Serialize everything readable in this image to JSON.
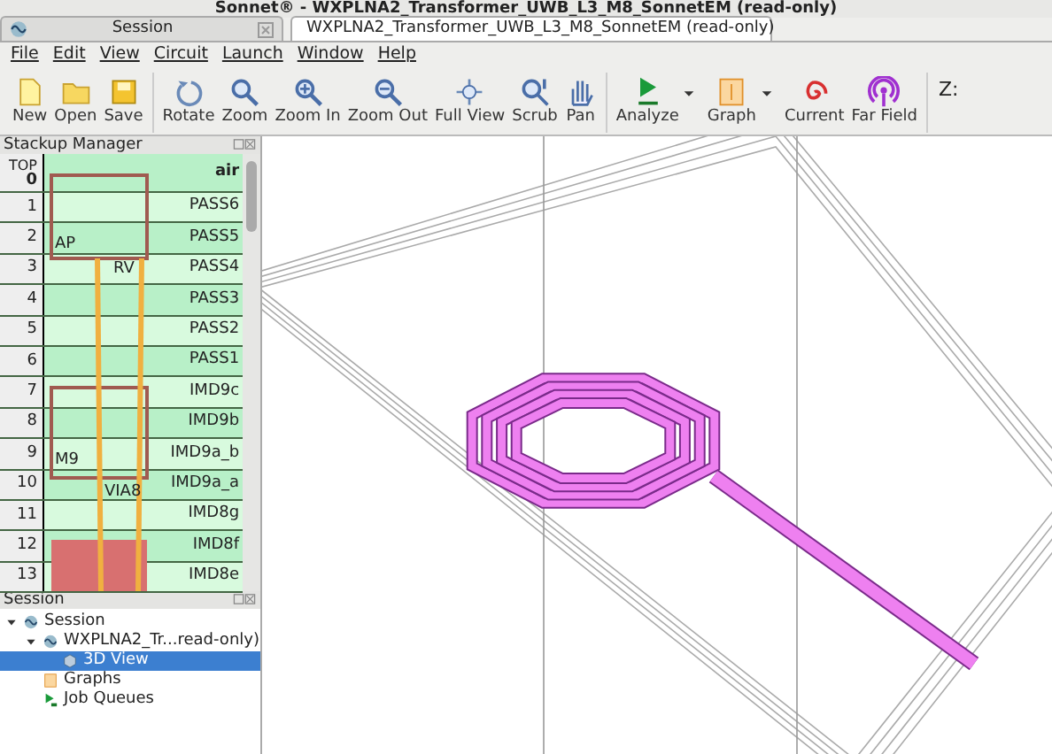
{
  "window": {
    "title": "Sonnet® - WXPLNA2_Transformer_UWB_L3_M8_SonnetEM (read-only)"
  },
  "tabs": [
    {
      "label": "Session",
      "selected": false,
      "kind": "session"
    },
    {
      "label": "WXPLNA2_Transformer_UWB_L3_M8_SonnetEM (read-only)",
      "selected": true,
      "kind": "project"
    }
  ],
  "menu": [
    "File",
    "Edit",
    "View",
    "Circuit",
    "Launch",
    "Window",
    "Help"
  ],
  "toolbar": {
    "groups": [
      [
        {
          "label": "New",
          "kind": "new"
        },
        {
          "label": "Open",
          "kind": "open"
        },
        {
          "label": "Save",
          "kind": "save"
        }
      ],
      [
        {
          "label": "Rotate",
          "kind": "rotate"
        },
        {
          "label": "Zoom",
          "kind": "zoom"
        },
        {
          "label": "Zoom In",
          "kind": "zoomin"
        },
        {
          "label": "Zoom Out",
          "kind": "zoomout"
        },
        {
          "label": "Full View",
          "kind": "fullview"
        },
        {
          "label": "Scrub",
          "kind": "scrub"
        },
        {
          "label": "Pan",
          "kind": "pan"
        }
      ],
      [
        {
          "label": "Analyze",
          "kind": "analyze",
          "dropdown": true
        },
        {
          "label": "Graph",
          "kind": "graph",
          "dropdown": true
        },
        {
          "label": "Current",
          "kind": "current"
        },
        {
          "label": "Far Field",
          "kind": "farfield"
        }
      ]
    ],
    "z_label": "Z:"
  },
  "stackup": {
    "title": "Stackup Manager",
    "top_label": "TOP",
    "rows": [
      {
        "number": "0",
        "name": "air"
      },
      {
        "number": "1",
        "name": "PASS6"
      },
      {
        "number": "2",
        "name": "PASS5"
      },
      {
        "number": "3",
        "name": "PASS4"
      },
      {
        "number": "4",
        "name": "PASS3"
      },
      {
        "number": "5",
        "name": "PASS2"
      },
      {
        "number": "6",
        "name": "PASS1"
      },
      {
        "number": "7",
        "name": "IMD9c"
      },
      {
        "number": "8",
        "name": "IMD9b"
      },
      {
        "number": "9",
        "name": "IMD9a_b"
      },
      {
        "number": "10",
        "name": "IMD9a_a"
      },
      {
        "number": "11",
        "name": "IMD8g"
      },
      {
        "number": "12",
        "name": "IMD8f"
      },
      {
        "number": "13",
        "name": "IMD8e"
      }
    ],
    "layer_labels": [
      "AP",
      "RV",
      "M9",
      "VIA8"
    ]
  },
  "session": {
    "title": "Session",
    "tree": [
      {
        "label": "Session",
        "kind": "session",
        "expanded": true,
        "selected": false,
        "children": [
          {
            "label": "WXPLNA2_Tr...read-only)",
            "kind": "project",
            "expanded": true,
            "selected": false,
            "children": [
              {
                "label": "3D View",
                "kind": "view",
                "selected": true
              }
            ]
          },
          {
            "label": "Graphs",
            "kind": "graphs",
            "selected": false
          },
          {
            "label": "Job Queues",
            "kind": "jobs",
            "selected": false
          }
        ]
      }
    ]
  }
}
